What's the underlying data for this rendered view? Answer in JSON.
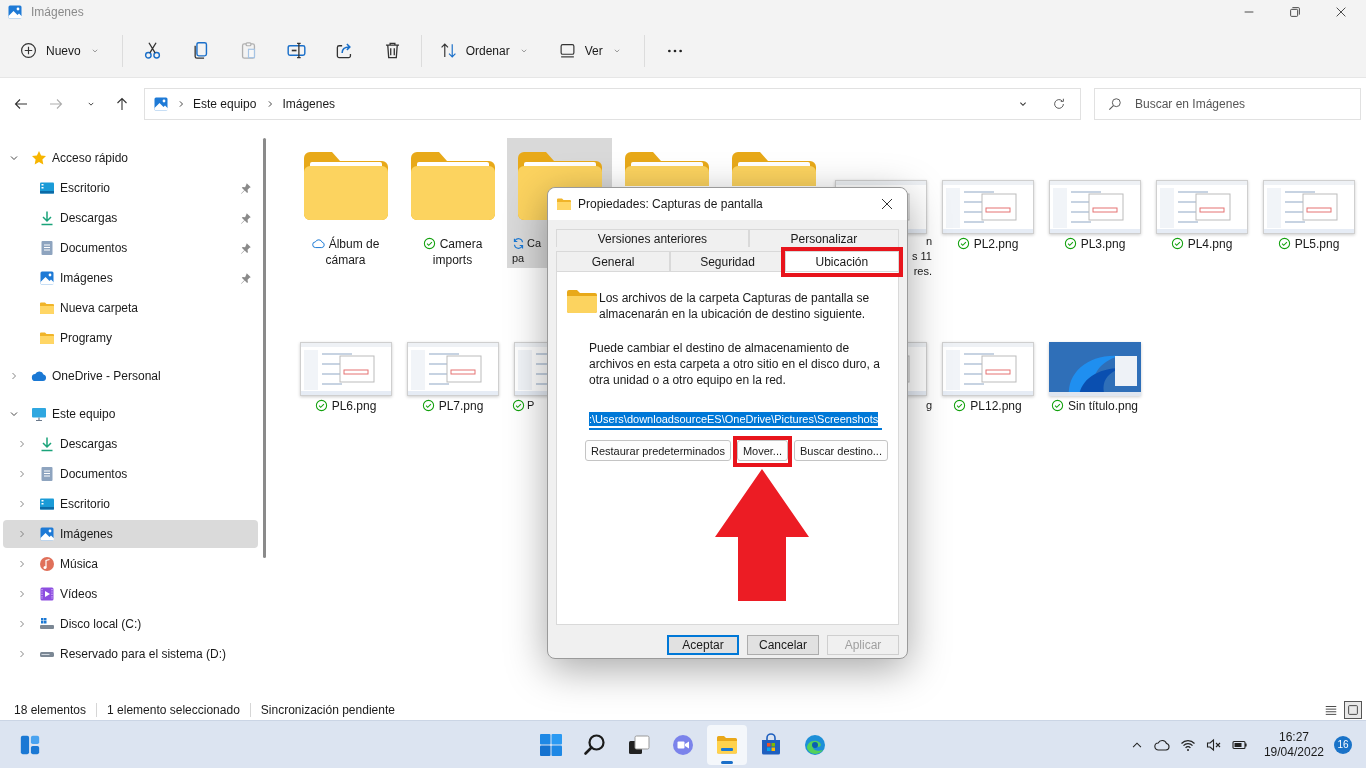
{
  "window": {
    "title": "Imágenes"
  },
  "toolbar": {
    "new_label": "Nuevo",
    "actions": [
      {
        "kind": "cut",
        "disabled": false
      },
      {
        "kind": "copy",
        "disabled": false
      },
      {
        "kind": "paste",
        "disabled": true
      },
      {
        "kind": "rename",
        "disabled": false
      },
      {
        "kind": "share",
        "disabled": false
      },
      {
        "kind": "delete",
        "disabled": false
      }
    ],
    "sort_label": "Ordenar",
    "view_label": "Ver"
  },
  "navigation": {
    "back_disabled": false,
    "forward_disabled": true
  },
  "address": {
    "crumbs": [
      "Este equipo",
      "Imágenes"
    ]
  },
  "search": {
    "placeholder": "Buscar en Imágenes"
  },
  "sidebar": {
    "items": [
      {
        "label": "Acceso rápido",
        "kind": "star",
        "expanded": true,
        "selected": false,
        "children": [
          {
            "label": "Escritorio",
            "kind": "desktop",
            "pinned": true,
            "selected": false
          },
          {
            "label": "Descargas",
            "kind": "downloads",
            "pinned": true,
            "selected": false
          },
          {
            "label": "Documentos",
            "kind": "documents",
            "pinned": true,
            "selected": false
          },
          {
            "label": "Imágenes",
            "kind": "pictures",
            "pinned": true,
            "selected": false
          },
          {
            "label": "Nueva carpeta",
            "kind": "folder",
            "pinned": false,
            "selected": false
          },
          {
            "label": "Programy",
            "kind": "folder",
            "pinned": false,
            "selected": false
          }
        ]
      },
      {
        "label": "OneDrive - Personal",
        "kind": "cloud",
        "expanded": false,
        "selected": false
      },
      {
        "label": "Este equipo",
        "kind": "pc",
        "expanded": true,
        "selected": false,
        "children": [
          {
            "label": "Descargas",
            "kind": "downloads",
            "expanded": false,
            "selected": false
          },
          {
            "label": "Documentos",
            "kind": "documents",
            "expanded": false,
            "selected": false
          },
          {
            "label": "Escritorio",
            "kind": "desktop",
            "expanded": false,
            "selected": false
          },
          {
            "label": "Imágenes",
            "kind": "pictures",
            "expanded": false,
            "selected": true
          },
          {
            "label": "Música",
            "kind": "music",
            "expanded": false,
            "selected": false
          },
          {
            "label": "Vídeos",
            "kind": "videos",
            "expanded": false,
            "selected": false
          },
          {
            "label": "Disco local (C:)",
            "kind": "drive_os",
            "expanded": false,
            "selected": false
          },
          {
            "label": "Reservado para el sistema (D:)",
            "kind": "drive",
            "expanded": false,
            "selected": false
          }
        ]
      }
    ]
  },
  "files": {
    "rows": [
      [
        {
          "kind": "folder",
          "label": "Álbum de cámara",
          "sync": {
            "kind": "cloud"
          },
          "selected": false
        },
        {
          "kind": "folder",
          "label": "Camera imports",
          "sync": {
            "kind": "synced"
          },
          "selected": false
        },
        {
          "kind": "folder",
          "fragments": [
            "Ca",
            "pa"
          ],
          "cut_left": false,
          "sync": {
            "kind": "syncing"
          },
          "selected": true
        },
        {
          "kind": "folder",
          "selected": false
        },
        {
          "kind": "folder",
          "selected": false
        },
        {
          "kind": "screenshot",
          "fragments": [
            "n",
            "s 11",
            "res."
          ],
          "cut_left": true,
          "selected": false
        },
        {
          "kind": "screenshot",
          "label": "PL2.png",
          "sync": {
            "kind": "synced"
          },
          "selected": false
        },
        {
          "kind": "screenshot",
          "label": "PL3.png",
          "sync": {
            "kind": "synced"
          },
          "selected": false
        },
        {
          "kind": "screenshot",
          "label": "PL4.png",
          "sync": {
            "kind": "synced"
          },
          "selected": false
        },
        {
          "kind": "screenshot",
          "label": "PL5.png",
          "sync": {
            "kind": "synced"
          },
          "selected": false
        }
      ],
      [
        {
          "kind": "screenshot",
          "label": "PL6.png",
          "sync": {
            "kind": "synced"
          },
          "selected": false
        },
        {
          "kind": "screenshot",
          "label": "PL7.png",
          "sync": {
            "kind": "synced"
          },
          "selected": false
        },
        {
          "kind": "screenshot",
          "fragments": [
            "P"
          ],
          "cut_left": false,
          "sync": {
            "kind": "synced"
          },
          "selected": false
        },
        {
          "kind": "covered"
        },
        {
          "kind": "covered"
        },
        {
          "kind": "screenshot",
          "fragments": [
            "g"
          ],
          "cut_left": true,
          "selected": false
        },
        {
          "kind": "screenshot",
          "label": "PL12.png",
          "sync": {
            "kind": "synced"
          },
          "selected": false
        },
        {
          "kind": "wallpaper",
          "label": "Sin título.png",
          "sync": {
            "kind": "synced"
          },
          "selected": false
        }
      ]
    ]
  },
  "dialog": {
    "title": "Propiedades: Capturas de pantalla",
    "tab_rows": [
      [
        {
          "label": "Versiones anteriores",
          "selected": false
        },
        {
          "label": "Personalizar",
          "selected": false
        }
      ],
      [
        {
          "label": "General",
          "selected": false
        },
        {
          "label": "Seguridad",
          "selected": false
        },
        {
          "label": "Ubicación",
          "selected": true,
          "highlighted": true
        }
      ]
    ],
    "description": "Los archivos de la carpeta Capturas de pantalla se almacenarán en la ubicación de destino siguiente.",
    "hint": "Puede cambiar el destino de almacenamiento de archivos en esta carpeta a otro sitio en el disco duro, a otra unidad o a otro equipo en la red.",
    "path": {
      "value": ":\\Users\\downloadsourceES\\OneDrive\\Pictures\\Screenshots",
      "selected": true
    },
    "actions": [
      {
        "label": "Restaurar predeterminados",
        "highlighted": false
      },
      {
        "label": "Mover...",
        "highlighted": true,
        "arrow": true
      },
      {
        "label": "Buscar destino...",
        "highlighted": false
      }
    ],
    "buttons": [
      {
        "label": "Aceptar",
        "default": true,
        "disabled": false
      },
      {
        "label": "Cancelar",
        "default": false,
        "disabled": false
      },
      {
        "label": "Aplicar",
        "default": false,
        "disabled": true
      }
    ]
  },
  "status_bar": {
    "items": [
      "18 elementos",
      "1 elemento seleccionado",
      "Sincronización pendiente"
    ],
    "views": [
      {
        "kind": "details",
        "selected": false
      },
      {
        "kind": "tiles",
        "selected": true
      }
    ]
  },
  "taskbar": {
    "apps": [
      {
        "kind": "start",
        "active": false
      },
      {
        "kind": "search",
        "active": false
      },
      {
        "kind": "taskview",
        "active": false
      },
      {
        "kind": "chat",
        "active": false
      },
      {
        "kind": "explorer",
        "active": true
      },
      {
        "kind": "store",
        "active": false
      },
      {
        "kind": "browser",
        "active": false
      }
    ],
    "volume_muted": true,
    "time": "16:27",
    "date": "19/04/2022",
    "notifications": "16"
  }
}
